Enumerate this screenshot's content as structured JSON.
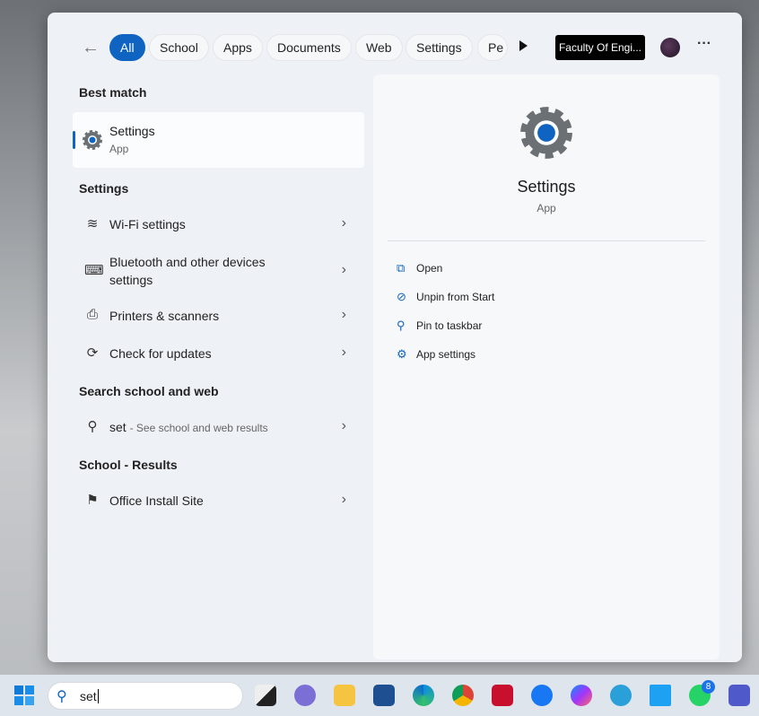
{
  "filters": [
    "All",
    "School",
    "Apps",
    "Documents",
    "Web",
    "Settings",
    "Pe"
  ],
  "org_label": "Faculty Of Engi...",
  "best_match": {
    "heading": "Best match",
    "title": "Settings",
    "subtitle": "App"
  },
  "settings": {
    "heading": "Settings",
    "items": [
      {
        "label": "Wi-Fi settings",
        "icon": "wifi-icon"
      },
      {
        "label": "Bluetooth and other devices",
        "label2": "settings",
        "icon": "keyboard-icon"
      },
      {
        "label": "Printers & scanners",
        "icon": "printer-icon"
      },
      {
        "label": "Check for updates",
        "icon": "sync-icon"
      }
    ]
  },
  "web": {
    "heading": "Search school and web",
    "query": "set",
    "hint": "- See school and web results"
  },
  "school": {
    "heading": "School - Results",
    "item": "Office Install Site"
  },
  "detail": {
    "title": "Settings",
    "subtitle": "App",
    "actions": [
      "Open",
      "Unpin from Start",
      "Pin to taskbar",
      "App settings"
    ]
  },
  "taskbar": {
    "search_value": "set",
    "whatsapp_badge": "8"
  }
}
